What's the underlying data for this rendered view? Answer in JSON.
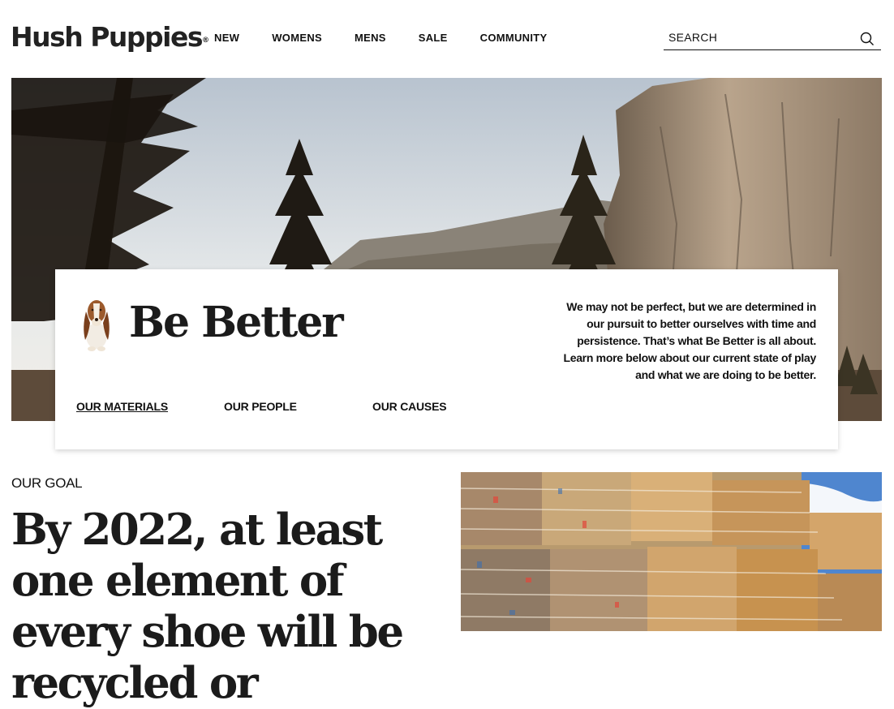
{
  "header": {
    "brand": "Hush Puppies",
    "brand_mark": "®",
    "nav": [
      "NEW",
      "WOMENS",
      "MENS",
      "SALE",
      "COMMUNITY"
    ],
    "search_placeholder": "SEARCH"
  },
  "hero": {
    "title": "Be Better",
    "description": "We may not be perfect, but we are determined in our pursuit to better ourselves with time and persistence. That’s what Be Better is all about. Learn more below about our current state of play and what we are doing to be better.",
    "subnav": [
      "OUR MATERIALS",
      "OUR PEOPLE",
      "OUR CAUSES"
    ],
    "active_subnav": "OUR MATERIALS"
  },
  "goal": {
    "label": "OUR GOAL",
    "headline": "By 2022, at least one element of every shoe will be recycled or"
  },
  "icons": {
    "search": "search-icon",
    "mascot": "basset-hound-logo"
  }
}
